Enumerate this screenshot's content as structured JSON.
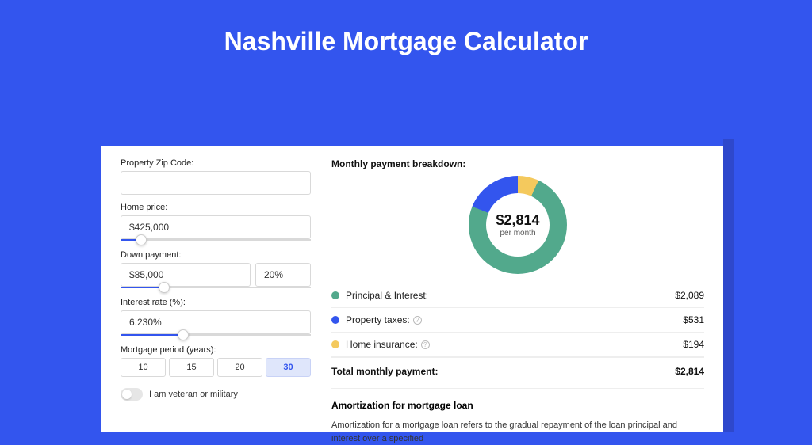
{
  "title": "Nashville Mortgage Calculator",
  "form": {
    "zip": {
      "label": "Property Zip Code:",
      "value": ""
    },
    "homePrice": {
      "label": "Home price:",
      "value": "$425,000",
      "sliderFill": 8
    },
    "downPayment": {
      "label": "Down payment:",
      "amount": "$85,000",
      "percent": "20%",
      "sliderFill": 20
    },
    "interest": {
      "label": "Interest rate (%):",
      "value": "6.230%",
      "sliderFill": 30
    },
    "period": {
      "label": "Mortgage period (years):",
      "options": [
        "10",
        "15",
        "20",
        "30"
      ],
      "active": "30"
    },
    "veteran": {
      "label": "I am veteran or military",
      "on": false
    }
  },
  "breakdown": {
    "heading": "Monthly payment breakdown:",
    "centerAmount": "$2,814",
    "centerSub": "per month",
    "items": [
      {
        "label": "Principal & Interest:",
        "value": "$2,089",
        "color": "#52a98c",
        "info": false
      },
      {
        "label": "Property taxes:",
        "value": "$531",
        "color": "#3355ee",
        "info": true
      },
      {
        "label": "Home insurance:",
        "value": "$194",
        "color": "#f4c95d",
        "info": true
      }
    ],
    "totalLabel": "Total monthly payment:",
    "totalValue": "$2,814"
  },
  "amort": {
    "heading": "Amortization for mortgage loan",
    "body": "Amortization for a mortgage loan refers to the gradual repayment of the loan principal and interest over a specified"
  },
  "chart_data": {
    "type": "pie",
    "title": "Monthly payment breakdown",
    "series": [
      {
        "name": "Principal & Interest",
        "value": 2089,
        "color": "#52a98c"
      },
      {
        "name": "Property taxes",
        "value": 531,
        "color": "#3355ee"
      },
      {
        "name": "Home insurance",
        "value": 194,
        "color": "#f4c95d"
      }
    ],
    "total": 2814,
    "unit": "USD per month"
  }
}
